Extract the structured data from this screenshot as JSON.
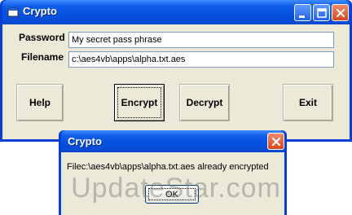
{
  "window": {
    "title": "Crypto",
    "password_label": "Password",
    "password_value": "My secret pass phrase",
    "filename_label": "Filename",
    "filename_value": "c:\\aes4vb\\apps\\alpha.txt.aes",
    "buttons": {
      "help": "Help",
      "encrypt": "Encrypt",
      "decrypt": "Decrypt",
      "exit": "Exit"
    }
  },
  "dialog": {
    "title": "Crypto",
    "message": "Filec:\\aes4vb\\apps\\alpha.txt.aes already encrypted",
    "ok_label": "OK"
  },
  "watermark": "UpdateStar.com",
  "icons": {
    "app": "window-app-icon",
    "minimize": "minimize-icon",
    "maximize": "maximize-icon",
    "close": "close-icon"
  },
  "colors": {
    "titlebar": "#0551e0",
    "close_button": "#d8461f",
    "client_background": "#ece9d8"
  }
}
